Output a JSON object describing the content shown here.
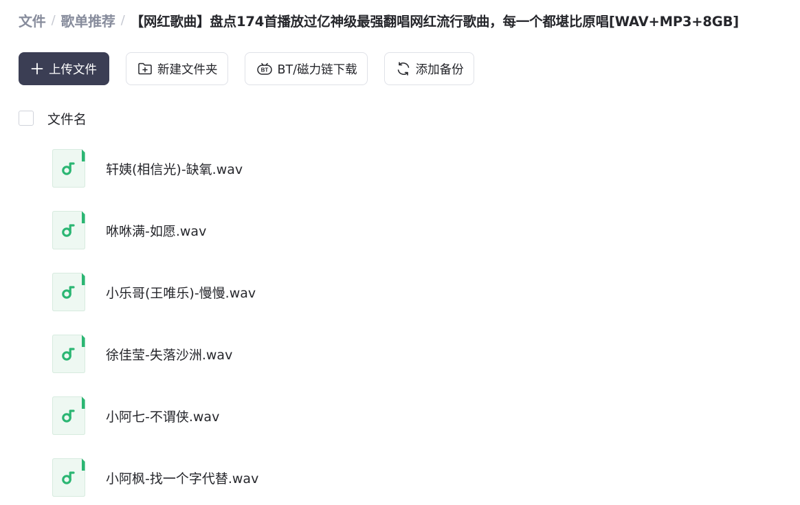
{
  "breadcrumb": {
    "items": [
      "文件",
      "歌单推荐"
    ],
    "separator": "/",
    "current": "【网红歌曲】盘点174首播放过亿神级最强翻唱网红流行歌曲，每一个都堪比原唱[WAV+MP3+8GB]"
  },
  "toolbar": {
    "upload_label": "上传文件",
    "upload_icon": "plus-icon",
    "new_folder_label": "新建文件夹",
    "new_folder_icon": "folder-plus-icon",
    "bt_label": "BT/磁力链下载",
    "bt_icon": "bt-icon",
    "backup_label": "添加备份",
    "backup_icon": "sync-icon"
  },
  "list": {
    "header_label": "文件名",
    "files": [
      {
        "name": "轩姨(相信光)-缺氧.wav",
        "icon": "audio-file-icon"
      },
      {
        "name": "咻咻满-如愿.wav",
        "icon": "audio-file-icon"
      },
      {
        "name": "小乐哥(王唯乐)-慢慢.wav",
        "icon": "audio-file-icon"
      },
      {
        "name": "徐佳莹-失落沙洲.wav",
        "icon": "audio-file-icon"
      },
      {
        "name": "小阿七-不谓侠.wav",
        "icon": "audio-file-icon"
      },
      {
        "name": "小阿枫-找一个字代替.wav",
        "icon": "audio-file-icon"
      }
    ]
  },
  "colors": {
    "primary_button": "#3b3e54",
    "audio_icon_green": "#2bb673",
    "audio_icon_bg": "#eef8f2",
    "breadcrumb_muted": "#878c9c",
    "text": "#25262b",
    "border": "#dfe1e7"
  }
}
